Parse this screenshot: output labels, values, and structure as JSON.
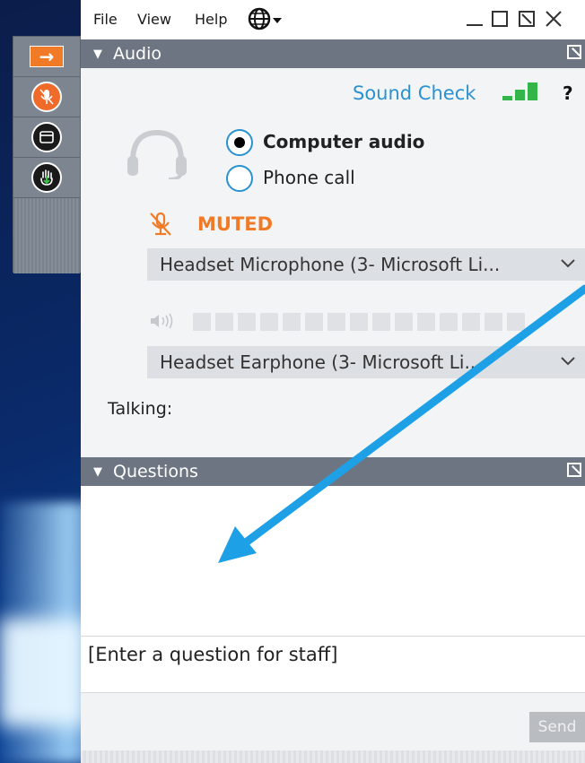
{
  "menubar": {
    "file": "File",
    "view": "View",
    "help": "Help"
  },
  "sidebar": {
    "icons": [
      "arrow-right-icon",
      "mic-muted-icon",
      "window-icon",
      "raise-hand-icon"
    ]
  },
  "audio": {
    "header": "Audio",
    "sound_check": "Sound Check",
    "help_mark": "?",
    "option_computer": "Computer audio",
    "option_phone": "Phone call",
    "selected_option": "Computer audio",
    "muted_label": "MUTED",
    "microphone_select": "Headset Microphone (3- Microsoft Li...",
    "speaker_select": "Headset Earphone (3- Microsoft Li...",
    "talking_label": "Talking:"
  },
  "questions": {
    "header": "Questions",
    "input_placeholder": "[Enter a question for staff]",
    "send_label": "Send"
  },
  "colors": {
    "accent_orange": "#f07a25",
    "accent_blue": "#2a92d0",
    "header_gray": "#6d7582",
    "annotation_arrow": "#1ea0e6"
  }
}
